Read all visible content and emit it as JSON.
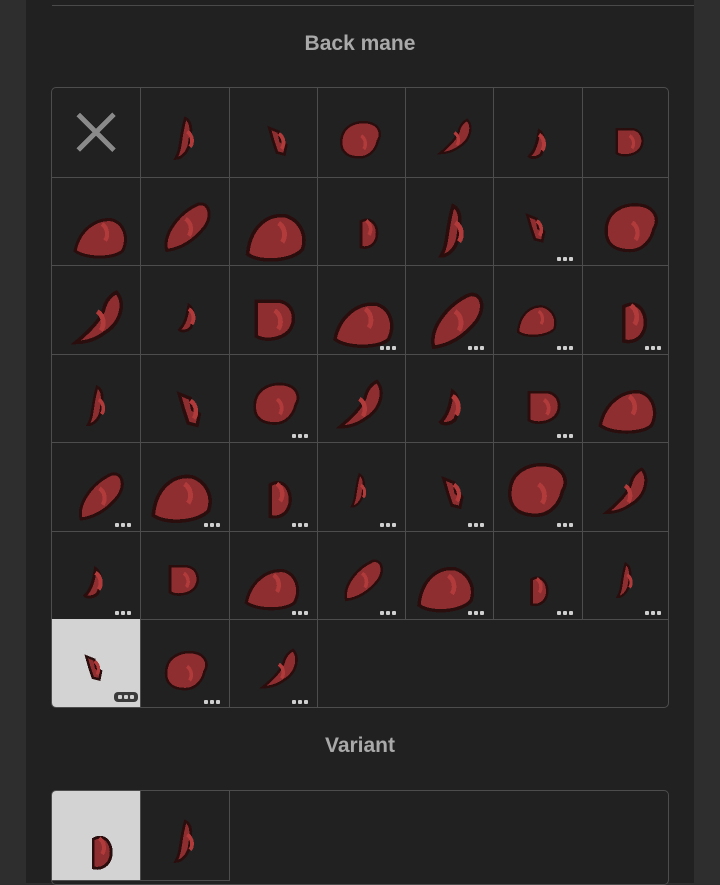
{
  "back_mane": {
    "title": "Back mane",
    "options": [
      {
        "icon": "none-x-icon",
        "more": false
      },
      {
        "icon": "mane-sprite-icon",
        "more": false
      },
      {
        "icon": "mane-sprite-icon",
        "more": false
      },
      {
        "icon": "mane-sprite-icon",
        "more": false
      },
      {
        "icon": "mane-sprite-icon",
        "more": false
      },
      {
        "icon": "mane-sprite-icon",
        "more": false
      },
      {
        "icon": "mane-sprite-icon",
        "more": false
      },
      {
        "icon": "mane-sprite-icon",
        "more": false
      },
      {
        "icon": "mane-sprite-icon",
        "more": false
      },
      {
        "icon": "mane-sprite-icon",
        "more": false
      },
      {
        "icon": "mane-sprite-icon",
        "more": false
      },
      {
        "icon": "mane-sprite-icon",
        "more": false
      },
      {
        "icon": "mane-sprite-icon",
        "more": true
      },
      {
        "icon": "mane-sprite-icon",
        "more": false
      },
      {
        "icon": "mane-sprite-icon",
        "more": false
      },
      {
        "icon": "mane-sprite-icon",
        "more": false
      },
      {
        "icon": "mane-sprite-icon",
        "more": false
      },
      {
        "icon": "mane-sprite-icon",
        "more": true
      },
      {
        "icon": "mane-sprite-icon",
        "more": true
      },
      {
        "icon": "mane-sprite-icon",
        "more": true
      },
      {
        "icon": "mane-sprite-icon",
        "more": true
      },
      {
        "icon": "mane-sprite-icon",
        "more": false
      },
      {
        "icon": "mane-sprite-icon",
        "more": false
      },
      {
        "icon": "mane-sprite-icon",
        "more": true
      },
      {
        "icon": "mane-sprite-icon",
        "more": false
      },
      {
        "icon": "mane-sprite-icon",
        "more": false
      },
      {
        "icon": "mane-sprite-icon",
        "more": true
      },
      {
        "icon": "mane-sprite-icon",
        "more": false
      },
      {
        "icon": "mane-sprite-icon",
        "more": true
      },
      {
        "icon": "mane-sprite-icon",
        "more": true
      },
      {
        "icon": "mane-sprite-icon",
        "more": true
      },
      {
        "icon": "mane-sprite-icon",
        "more": true
      },
      {
        "icon": "mane-sprite-icon",
        "more": true
      },
      {
        "icon": "mane-sprite-icon",
        "more": true
      },
      {
        "icon": "mane-sprite-icon",
        "more": false
      },
      {
        "icon": "mane-sprite-icon",
        "more": true
      },
      {
        "icon": "mane-sprite-icon",
        "more": false
      },
      {
        "icon": "mane-sprite-icon",
        "more": true
      },
      {
        "icon": "mane-sprite-icon",
        "more": true
      },
      {
        "icon": "mane-sprite-icon",
        "more": true
      },
      {
        "icon": "mane-sprite-icon",
        "more": true
      },
      {
        "icon": "mane-sprite-icon",
        "more": true
      },
      {
        "icon": "mane-sprite-icon",
        "more": true,
        "selected": true
      },
      {
        "icon": "mane-sprite-icon",
        "more": true
      },
      {
        "icon": "mane-sprite-icon",
        "more": true
      }
    ]
  },
  "variant": {
    "title": "Variant",
    "options": [
      {
        "icon": "mane-sprite-icon",
        "selected": true
      },
      {
        "icon": "mane-sprite-icon",
        "selected": false
      }
    ]
  },
  "colors": {
    "mane_fill": "#8f2e30",
    "mane_light": "#b13b3b",
    "mane_outline": "#2a0e0e",
    "accent_red": "#e02a2a",
    "selected_bg": "#d3d3d3"
  }
}
